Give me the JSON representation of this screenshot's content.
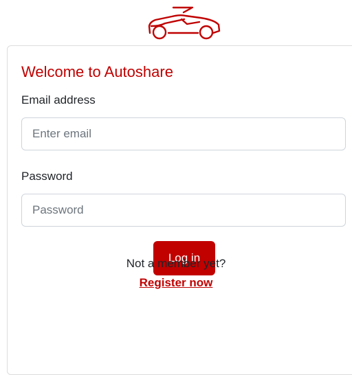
{
  "logo": {
    "icon": "convertible-car-icon",
    "color": "#c00000"
  },
  "login_card": {
    "title": "Welcome to Autoshare",
    "email": {
      "label": "Email address",
      "placeholder": "Enter email",
      "value": ""
    },
    "password": {
      "label": "Password",
      "placeholder": "Password",
      "value": ""
    },
    "login_button": "Log in",
    "register_prompt": "Not a member yet?",
    "register_link": "Register now"
  },
  "colors": {
    "accent": "#c00000",
    "button_bg": "#c10000",
    "text": "#212529",
    "border": "#ced4da",
    "placeholder": "#6c757d"
  }
}
